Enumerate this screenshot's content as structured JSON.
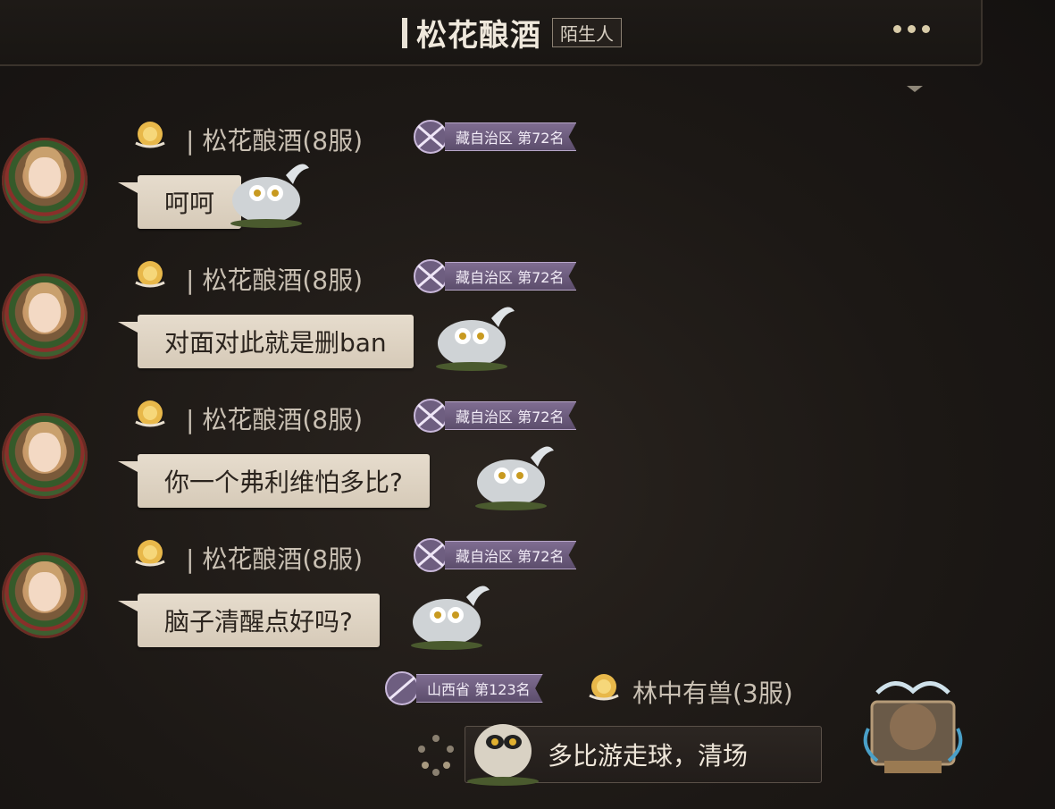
{
  "header": {
    "title": "松花酿酒",
    "relation_tag": "陌生人",
    "more_icon": "ellipsis-icon"
  },
  "messages": [
    {
      "sender": "| 松花酿酒(8服)",
      "rank": "藏自治区 第72名",
      "text": "呵呵"
    },
    {
      "sender": "| 松花酿酒(8服)",
      "rank": "藏自治区 第72名",
      "text": "对面对此就是删ban"
    },
    {
      "sender": "| 松花酿酒(8服)",
      "rank": "藏自治区 第72名",
      "text": "你一个弗利维怕多比?"
    },
    {
      "sender": "| 松花酿酒(8服)",
      "rank": "藏自治区 第72名",
      "text": "脑子清醒点好吗?"
    }
  ],
  "outgoing": {
    "sender": "林中有兽(3服)",
    "rank": "山西省 第123名",
    "text": "多比游走球，清场"
  },
  "colors": {
    "background": "#1c1815",
    "bubble_in": "#e6dccd",
    "bubble_out": "#2c2622",
    "rank_ribbon": "#6e5e80"
  }
}
